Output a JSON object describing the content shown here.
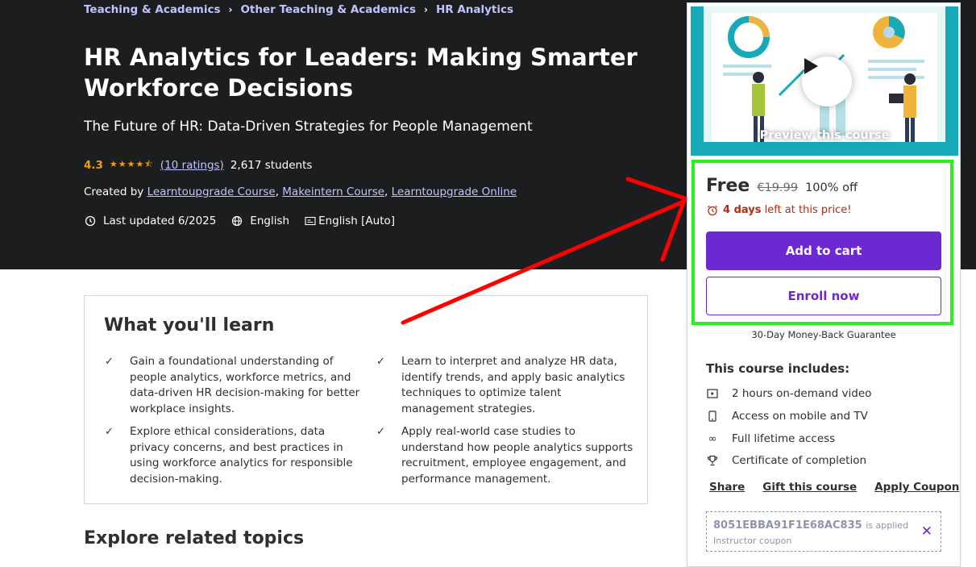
{
  "breadcrumb": [
    "Teaching & Academics",
    "Other Teaching & Academics",
    "HR Analytics"
  ],
  "course": {
    "title": "HR Analytics for Leaders: Making Smarter Workforce Decisions",
    "subtitle": "The Future of HR: Data-Driven Strategies for People Management",
    "rating": "4.3",
    "ratings_count": "(10 ratings)",
    "students": "2,617 students",
    "created_by_label": "Created by",
    "instructors": [
      "Learntoupgrade Course",
      "Makeintern Course",
      "Learntoupgrade Online"
    ],
    "last_updated": "Last updated 6/2025",
    "language": "English",
    "captions": "English [Auto]"
  },
  "learn": {
    "heading": "What you'll learn",
    "items": [
      "Gain a foundational understanding of people analytics, workforce metrics, and data-driven HR decision-making for better workplace insights.",
      "Learn to interpret and analyze HR data, identify trends, and apply basic analytics techniques to optimize talent management strategies.",
      "Explore ethical considerations, data privacy concerns, and best practices in using workforce analytics for responsible decision-making.",
      "Apply real-world case studies to understand how people analytics supports recruitment, employee engagement, and performance management."
    ]
  },
  "explore_heading": "Explore related topics",
  "sidebar": {
    "preview_label": "Preview this course",
    "price": "Free",
    "original_price": "€19.99",
    "discount": "100% off",
    "timer_bold": "4 days",
    "timer_rest": "left at this price!",
    "add_to_cart": "Add to cart",
    "enroll_now": "Enroll now",
    "guarantee": "30-Day Money-Back Guarantee",
    "includes_title": "This course includes:",
    "includes": [
      {
        "icon": "video-icon",
        "text": "2 hours on-demand video"
      },
      {
        "icon": "mobile-icon",
        "text": "Access on mobile and TV"
      },
      {
        "icon": "infinity-icon",
        "text": "Full lifetime access"
      },
      {
        "icon": "trophy-icon",
        "text": "Certificate of completion"
      }
    ],
    "links": [
      "Share",
      "Gift this course",
      "Apply Coupon"
    ],
    "coupon_code": "8051EBBA91F1E68AC835",
    "coupon_applied": "is applied",
    "coupon_type": "Instructor coupon"
  },
  "colors": {
    "hero_bg": "#1c1d1f",
    "accent_purple": "#6d28d2",
    "link_lavender": "#c0c4fc",
    "star": "#f69c08",
    "timer_red": "#b32d0f",
    "highlight_green": "#2bf020",
    "annotation_red": "#ff0000"
  }
}
